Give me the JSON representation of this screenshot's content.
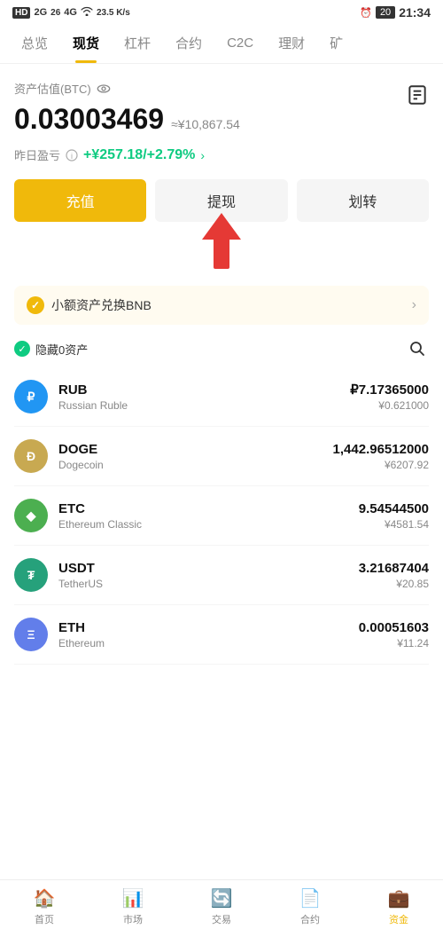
{
  "statusBar": {
    "leftItems": [
      "HD",
      "2G",
      "26",
      "46"
    ],
    "network": "23.5 K/s",
    "time": "21:34"
  },
  "navTabs": {
    "items": [
      "总览",
      "现货",
      "杠杆",
      "合约",
      "C2C",
      "理财",
      "矿"
    ],
    "activeIndex": 1
  },
  "portfolio": {
    "assetLabel": "资产估值(BTC)",
    "btcValue": "0.03003469",
    "cnyApprox": "≈¥10,867.54",
    "pnlLabel": "昨日盈亏",
    "pnlValue": "+¥257.18/+2.79%"
  },
  "actionButtons": {
    "deposit": "充值",
    "withdraw": "提现",
    "transfer": "划转"
  },
  "bnbBanner": {
    "text": "小额资产兑换BNB"
  },
  "filterRow": {
    "hideLabel": "隐藏0资产"
  },
  "assets": [
    {
      "symbol": "RUB",
      "name": "Russian Ruble",
      "amount": "₽7.17365000",
      "cny": "¥0.621000",
      "logoText": "₽",
      "logoClass": "logo-rub"
    },
    {
      "symbol": "DOGE",
      "name": "Dogecoin",
      "amount": "1,442.96512000",
      "cny": "¥6207.92",
      "logoText": "Ð",
      "logoClass": "logo-doge"
    },
    {
      "symbol": "ETC",
      "name": "Ethereum Classic",
      "amount": "9.54544500",
      "cny": "¥4581.54",
      "logoText": "◆",
      "logoClass": "logo-etc"
    },
    {
      "symbol": "USDT",
      "name": "TetherUS",
      "amount": "3.21687404",
      "cny": "¥20.85",
      "logoText": "₮",
      "logoClass": "logo-usdt"
    },
    {
      "symbol": "ETH",
      "name": "Ethereum",
      "amount": "0.00051603",
      "cny": "¥11.24",
      "logoText": "Ξ",
      "logoClass": "logo-eth"
    }
  ],
  "bottomNav": {
    "items": [
      {
        "icon": "🏠",
        "label": "首页"
      },
      {
        "icon": "📊",
        "label": "市场"
      },
      {
        "icon": "🔄",
        "label": "交易"
      },
      {
        "icon": "📄",
        "label": "合约"
      },
      {
        "icon": "💼",
        "label": "资金"
      }
    ],
    "activeIndex": 4
  }
}
